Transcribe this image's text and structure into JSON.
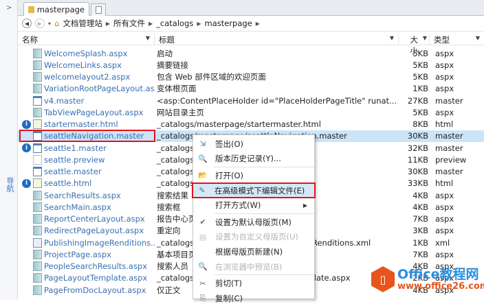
{
  "sidebar": {
    "label": "导航"
  },
  "tabs": [
    {
      "label": "masterpage"
    }
  ],
  "breadcrumb": [
    "文档管理站",
    "所有文件",
    "_catalogs",
    "masterpage"
  ],
  "columns": {
    "name": "名称",
    "title": "标题",
    "size": "大小",
    "type": "类型"
  },
  "rows": [
    {
      "name": "WelcomeSplash.aspx",
      "title": "启动",
      "size": "5KB",
      "type": "aspx",
      "icon": "aspx",
      "info": false
    },
    {
      "name": "WelcomeLinks.aspx",
      "title": "摘要链接",
      "size": "5KB",
      "type": "aspx",
      "icon": "aspx",
      "info": false
    },
    {
      "name": "welcomelayout2.aspx",
      "title": "包含 Web 部件区域的欢迎页面",
      "size": "5KB",
      "type": "aspx",
      "icon": "aspx",
      "info": false
    },
    {
      "name": "VariationRootPageLayout.as...",
      "title": "变体根页面",
      "size": "1KB",
      "type": "aspx",
      "icon": "aspx",
      "info": false
    },
    {
      "name": "v4.master",
      "title": "<asp:ContentPlaceHolder id=\"PlaceHolderPageTitle\" runat...",
      "size": "27KB",
      "type": "master",
      "icon": "master",
      "info": false
    },
    {
      "name": "TabViewPageLayout.aspx",
      "title": "网站目录主页",
      "size": "5KB",
      "type": "aspx",
      "icon": "aspx",
      "info": false
    },
    {
      "name": "startermaster.html",
      "title": "_catalogs/masterpage/startermaster.html",
      "size": "8KB",
      "type": "html",
      "icon": "html",
      "info": true
    },
    {
      "name": "seattleNavigation.master",
      "title": "_catalogs/masterpage/seattleNavigation.master",
      "size": "30KB",
      "type": "master",
      "icon": "master",
      "info": false,
      "selected": true
    },
    {
      "name": "seattle1.master",
      "title": "_catalogs/",
      "size": "32KB",
      "type": "master",
      "icon": "master",
      "info": true
    },
    {
      "name": "seattle.preview",
      "title": "_catalogs/",
      "size": "11KB",
      "type": "preview",
      "icon": "preview",
      "info": false
    },
    {
      "name": "seattle.master",
      "title": "_catalogs/",
      "size": "30KB",
      "type": "master",
      "icon": "master",
      "info": false
    },
    {
      "name": "seattle.html",
      "title": "_catalogs/",
      "size": "33KB",
      "type": "html",
      "icon": "html",
      "info": true
    },
    {
      "name": "SearchResults.aspx",
      "title": "搜索结果",
      "size": "4KB",
      "type": "aspx",
      "icon": "aspx",
      "info": false
    },
    {
      "name": "SearchMain.aspx",
      "title": "搜索框",
      "size": "4KB",
      "type": "aspx",
      "icon": "aspx",
      "info": false
    },
    {
      "name": "ReportCenterLayout.aspx",
      "title": "报告中心页",
      "size": "7KB",
      "type": "aspx",
      "icon": "aspx",
      "info": false
    },
    {
      "name": "RedirectPageLayout.aspx",
      "title": "重定向",
      "size": "3KB",
      "type": "aspx",
      "icon": "aspx",
      "info": false
    },
    {
      "name": "PublishingImageRenditions....",
      "title": "_catalogs/masterpage/PublishingImageRenditions.xml",
      "size": "1KB",
      "type": "xml",
      "icon": "xml",
      "info": false
    },
    {
      "name": "ProjectPage.aspx",
      "title": "基本项目页",
      "size": "7KB",
      "type": "aspx",
      "icon": "aspx",
      "info": false
    },
    {
      "name": "PeopleSearchResults.aspx",
      "title": "搜索人员",
      "size": "4KB",
      "type": "aspx",
      "icon": "aspx",
      "info": false
    },
    {
      "name": "PageLayoutTemplate.aspx",
      "title": "_catalogs/masterpage/PageLayoutTemplate.aspx",
      "size": "2KB",
      "type": "aspx",
      "icon": "aspx",
      "info": false
    },
    {
      "name": "PageFromDocLayout.aspx",
      "title": "仅正文",
      "size": "4KB",
      "type": "aspx",
      "icon": "aspx",
      "info": false
    }
  ],
  "context_menu": [
    {
      "label": "签出(O)",
      "icon": "checkout-icon",
      "enabled": true
    },
    {
      "label": "版本历史记录(Y)...",
      "icon": "history-icon",
      "enabled": true,
      "sep_after": true
    },
    {
      "label": "打开(O)",
      "icon": "folder-open-icon",
      "enabled": true
    },
    {
      "label": "在高级模式下编辑文件(E)",
      "icon": "edit-advanced-icon",
      "enabled": true,
      "highlighted": true
    },
    {
      "label": "打开方式(W)",
      "icon": "",
      "enabled": true,
      "submenu": true,
      "sep_after": true
    },
    {
      "label": "设置为默认母版页(M)",
      "icon": "set-default-icon",
      "enabled": true
    },
    {
      "label": "设置为自定义母版页(U)",
      "icon": "set-custom-icon",
      "enabled": false
    },
    {
      "label": "根据母版页新建(N)",
      "icon": "",
      "enabled": true
    },
    {
      "label": "在浏览器中预览(B)",
      "icon": "preview-icon",
      "enabled": false,
      "sep_after": true
    },
    {
      "label": "剪切(T)",
      "icon": "cut-icon",
      "enabled": true
    },
    {
      "label": "复制(C)",
      "icon": "copy-icon",
      "enabled": true
    }
  ],
  "watermark": {
    "line1": "Office教程网",
    "line2": "www.office26.com"
  }
}
